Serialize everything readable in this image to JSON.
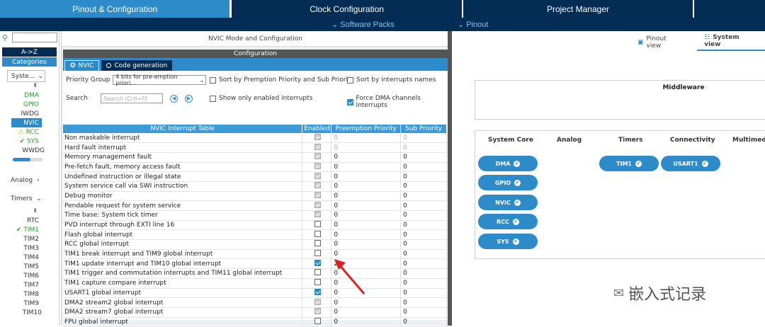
{
  "topbar": {
    "tabs": [
      "Pinout & Configuration",
      "Clock Configuration",
      "Project Manager"
    ]
  },
  "subbar": {
    "software_packs": "Software Packs",
    "pinout": "Pinout"
  },
  "left": {
    "search_placeholder": "",
    "az": "A->Z",
    "categories": "Categories",
    "system_group": "Syste...",
    "system_items": [
      "DMA",
      "GPIO",
      "IWDG",
      "NVIC",
      "RCC",
      "SYS",
      "WWDG"
    ],
    "analog_group": "Analog",
    "timers_group": "Timers",
    "timer_items": [
      "RTC",
      "TIM1",
      "TIM2",
      "TIM3",
      "TIM4",
      "TIM5",
      "TIM6",
      "TIM7",
      "TIM8",
      "TIM9",
      "TIM10"
    ]
  },
  "center": {
    "title": "NVIC Mode and Configuration",
    "config_header": "Configuration",
    "tab_nvic": "NVIC",
    "tab_codegen": "Code generation",
    "priority_group_label": "Priority Group",
    "priority_group_value": "4 bits for pre-emption priori...",
    "sort_premption": "Sort by Premption Priority and Sub Priority",
    "sort_names": "Sort by interrupts names",
    "search_label": "Search",
    "search_placeholder": "Search (Crtl+F)",
    "show_enabled": "Show only enabled interrupts",
    "force_dma": "Force DMA channels Interrupts",
    "table": {
      "headers": [
        "NVIC Interrupt Table",
        "Enabled",
        "Preemption Priority",
        "Sub Priority"
      ],
      "rows": [
        {
          "name": "Non maskable interrupt",
          "enabled": "fixed",
          "pre": "0",
          "sub": "0",
          "gray": true
        },
        {
          "name": "Hard fault interrupt",
          "enabled": "fixed",
          "pre": "0",
          "sub": "0",
          "gray": true
        },
        {
          "name": "Memory management fault",
          "enabled": "fixed",
          "pre": "0",
          "sub": "0",
          "gray": false
        },
        {
          "name": "Pre-fetch fault, memory access fault",
          "enabled": "fixed",
          "pre": "0",
          "sub": "0",
          "gray": false
        },
        {
          "name": "Undefined instruction or illegal state",
          "enabled": "fixed",
          "pre": "0",
          "sub": "0",
          "gray": false
        },
        {
          "name": "System service call via SWI instruction",
          "enabled": "fixed",
          "pre": "0",
          "sub": "0",
          "gray": false
        },
        {
          "name": "Debug monitor",
          "enabled": "fixed",
          "pre": "0",
          "sub": "0",
          "gray": false
        },
        {
          "name": "Pendable request for system service",
          "enabled": "fixed",
          "pre": "0",
          "sub": "0",
          "gray": false
        },
        {
          "name": "Time base: System tick timer",
          "enabled": "fixed",
          "pre": "0",
          "sub": "0",
          "gray": false
        },
        {
          "name": "PVD interrupt through EXTI line 16",
          "enabled": "off",
          "pre": "0",
          "sub": "0",
          "gray": false
        },
        {
          "name": "Flash global interrupt",
          "enabled": "off",
          "pre": "0",
          "sub": "0",
          "gray": false
        },
        {
          "name": "RCC global interrupt",
          "enabled": "off",
          "pre": "0",
          "sub": "0",
          "gray": false
        },
        {
          "name": "TIM1 break interrupt and TIM9 global interrupt",
          "enabled": "off",
          "pre": "0",
          "sub": "0",
          "gray": false
        },
        {
          "name": "TIM1 update interrupt and TIM10 global interrupt",
          "enabled": "on",
          "pre": "2",
          "sub": "0",
          "gray": false
        },
        {
          "name": "TIM1 trigger and commutation interrupts and TIM11 global interrupt",
          "enabled": "off",
          "pre": "0",
          "sub": "0",
          "gray": false
        },
        {
          "name": "TIM1 capture compare interrupt",
          "enabled": "off",
          "pre": "0",
          "sub": "0",
          "gray": false
        },
        {
          "name": "USART1 global interrupt",
          "enabled": "on",
          "pre": "0",
          "sub": "0",
          "gray": false
        },
        {
          "name": "DMA2 stream2 global interrupt",
          "enabled": "fixed",
          "pre": "0",
          "sub": "0",
          "gray": false
        },
        {
          "name": "DMA2 stream7 global interrupt",
          "enabled": "fixed",
          "pre": "0",
          "sub": "0",
          "gray": false
        },
        {
          "name": "FPU global interrupt",
          "enabled": "off",
          "pre": "0",
          "sub": "0",
          "gray": false
        }
      ]
    }
  },
  "right": {
    "pinout_view": "Pinout view",
    "system_view": "System view",
    "middleware": "Middleware",
    "columns": [
      "System Core",
      "Analog",
      "Timers",
      "Connectivity",
      "Multimedia"
    ],
    "core_pills": [
      "DMA",
      "GPIO",
      "NVIC",
      "RCC",
      "SYS"
    ],
    "timer_pills": [
      "TIM1"
    ],
    "conn_pills": [
      "USART1"
    ],
    "watermark": "嵌入式记录"
  },
  "colors": {
    "accent": "#2e8bc9",
    "dark": "#032d55",
    "arrow": "#e02020"
  }
}
